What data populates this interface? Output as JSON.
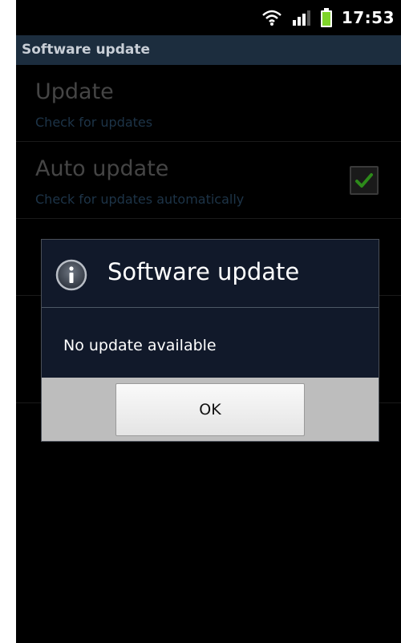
{
  "status_bar": {
    "time": "17:53",
    "icons": [
      "wifi-icon",
      "signal-icon",
      "battery-icon"
    ],
    "battery_color": "#7fd42a"
  },
  "screen": {
    "title": "Software update"
  },
  "settings": {
    "items": [
      {
        "title": "Update",
        "subtitle": "Check for updates"
      },
      {
        "title": "Auto update",
        "subtitle": "Check for updates automatically",
        "checked": true
      }
    ]
  },
  "dialog": {
    "title": "Software update",
    "icon": "info-icon",
    "message": "No update available",
    "ok_label": "OK"
  },
  "colors": {
    "title_bar_bg": "#1c2d3e",
    "dialog_bg": "#11192a",
    "checkmark": "#2d8a1a"
  }
}
